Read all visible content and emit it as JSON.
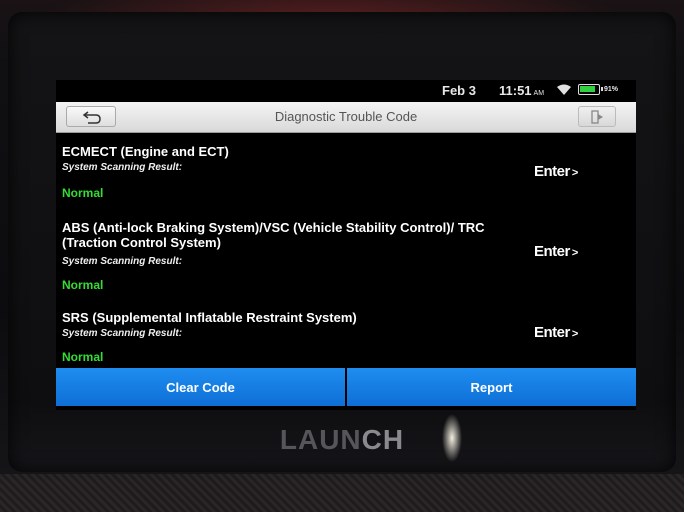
{
  "status": {
    "date": "Feb 3",
    "time": "11:51",
    "ampm": "AM",
    "battery_pct": "91%",
    "battery_level": 0.91
  },
  "header": {
    "title": "Diagnostic Trouble Code",
    "back_icon": "back-arrow-icon",
    "exit_icon": "exit-icon"
  },
  "systems": [
    {
      "name": "ECMECT (Engine and ECT)",
      "label": "System Scanning Result:",
      "result": "Normal",
      "enter_label": "Enter"
    },
    {
      "name": "ABS (Anti-lock Braking System)/VSC (Vehicle Stability Control)/ TRC (Traction Control System)",
      "label": "System Scanning Result:",
      "result": "Normal",
      "enter_label": "Enter"
    },
    {
      "name": "SRS (Supplemental Inflatable Restraint System)",
      "label": "System Scanning Result:",
      "result": "Normal",
      "enter_label": "Enter"
    }
  ],
  "actions": {
    "clear_code": "Clear Code",
    "report": "Report"
  },
  "colors": {
    "accent": "#1a85ee",
    "normal": "#33dd33"
  },
  "brand": {
    "name_main": "LAUN",
    "name_tail": "CH"
  }
}
